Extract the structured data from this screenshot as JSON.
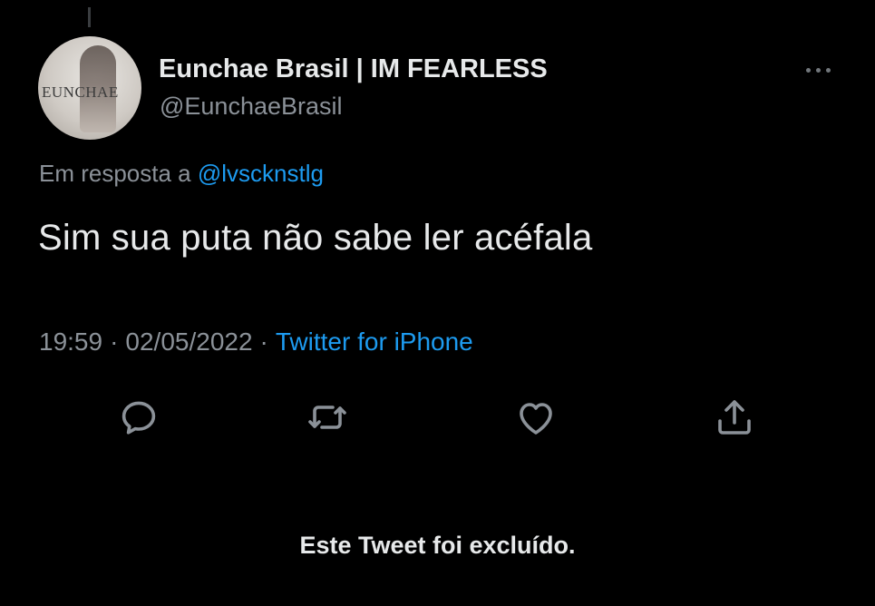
{
  "colors": {
    "background": "#000000",
    "primary_text": "#e7e9ea",
    "secondary_text": "#8b9198",
    "link": "#1d9bf0",
    "icon": "#8b9198"
  },
  "tweet": {
    "author": {
      "display_name": "Eunchae Brasil | IM FEARLESS",
      "handle": "@EunchaeBrasil",
      "avatar_text": "EUNCHAE",
      "avatar_icon": "profile-avatar"
    },
    "more_icon": "more-horizontal-icon",
    "reply_context": {
      "prefix": "Em resposta a",
      "mention": "@lvscknstlg"
    },
    "text": "Sim sua puta não sabe ler acéfala",
    "meta": {
      "time": "19:59",
      "date": "02/05/2022",
      "source": "Twitter for iPhone",
      "separator": "·"
    },
    "actions": [
      {
        "name": "reply",
        "icon": "reply-icon"
      },
      {
        "name": "retweet",
        "icon": "retweet-icon"
      },
      {
        "name": "like",
        "icon": "heart-icon"
      },
      {
        "name": "share",
        "icon": "share-icon"
      }
    ]
  },
  "deleted_notice": "Este Tweet foi excluído."
}
